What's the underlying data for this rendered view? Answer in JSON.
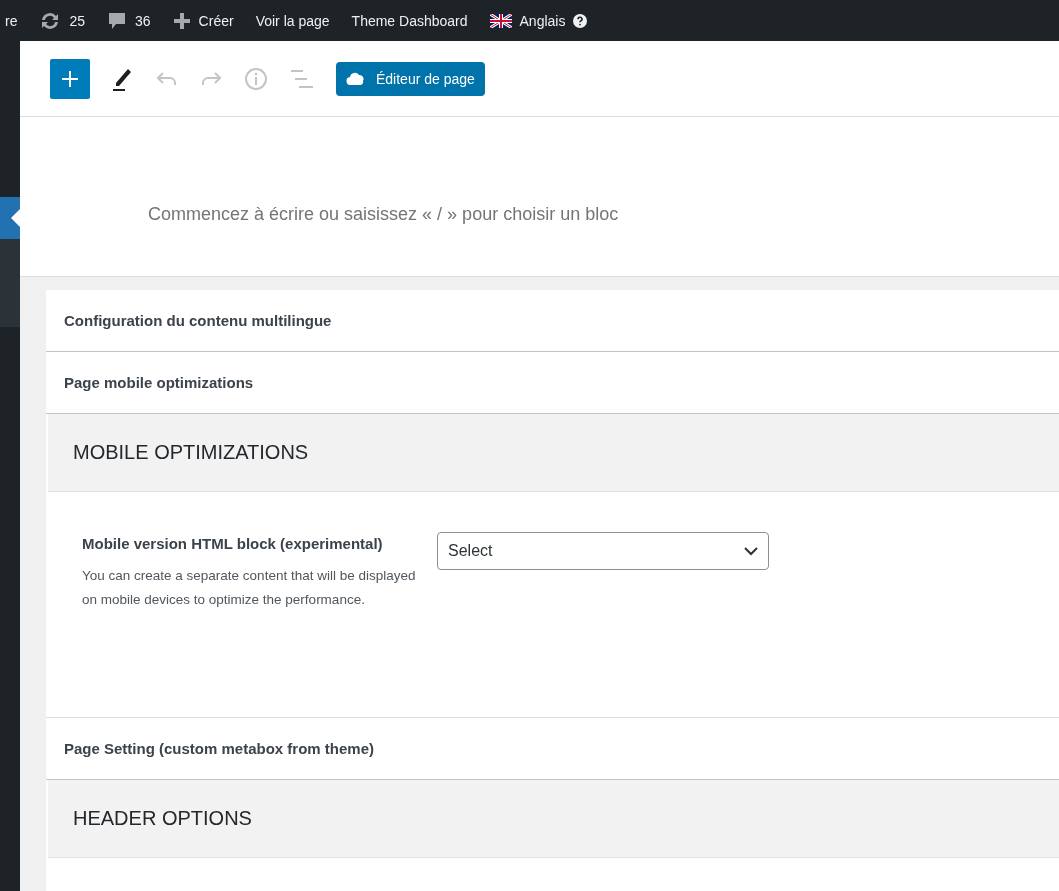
{
  "admin_bar": {
    "site_name_fragment": "re",
    "updates": "25",
    "comments": "36",
    "create": "Créer",
    "view_page": "Voir la page",
    "theme_dashboard": "Theme Dashboard",
    "language": "Anglais"
  },
  "toolbar": {
    "page_editor_button": "Éditeur de page"
  },
  "editor": {
    "block_placeholder": "Commencez à écrire ou saisissez « / » pour choisir un bloc"
  },
  "metaboxes": [
    {
      "kind": "header",
      "title": "Configuration du contenu multilingue"
    },
    {
      "kind": "header",
      "title": "Page mobile optimizations"
    },
    {
      "kind": "section",
      "title": "MOBILE OPTIMIZATIONS"
    },
    {
      "kind": "field",
      "label": "Mobile version HTML block (experimental)",
      "description": "You can create a separate content that will be displayed on mobile devices to optimize the performance.",
      "select_value": "Select"
    },
    {
      "kind": "header",
      "title": "Page Setting (custom metabox from theme)"
    },
    {
      "kind": "section",
      "title": "HEADER OPTIONS"
    }
  ]
}
